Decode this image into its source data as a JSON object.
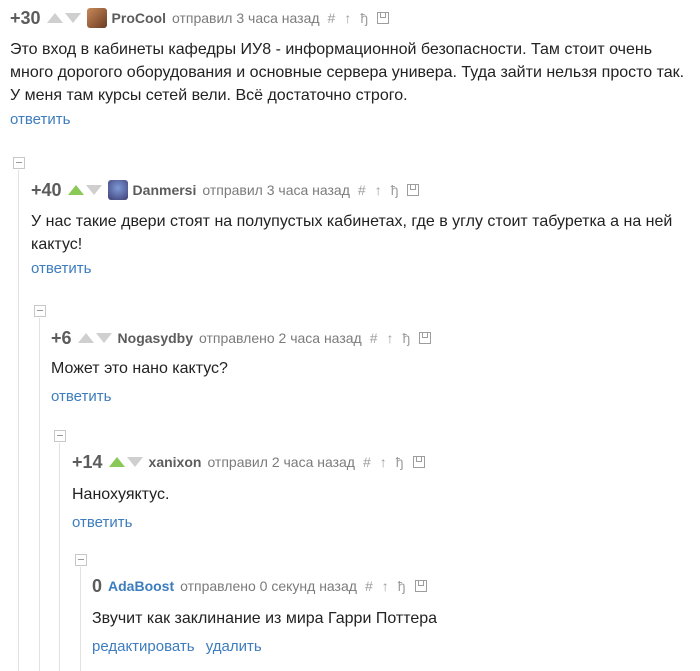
{
  "comments": [
    {
      "rating": "+30",
      "user": "ProCool",
      "action": "отправил 3 часа назад",
      "text": "Это вход в кабинеты кафедры ИУ8 - информационной безопасности. Там стоит очень много дорогого оборудования и основные сервера универа. Туда зайти нельзя просто так. У меня там курсы сетей вели. Всё достаточно строго.",
      "reply": "ответить"
    },
    {
      "rating": "+40",
      "user": "Danmersi",
      "action": "отправил 3 часа назад",
      "text": "У нас такие двери стоят на полупустых кабинетах, где в углу стоит табуретка а на ней кактус!",
      "reply": "ответить"
    },
    {
      "rating": "+6",
      "user": "Nogasydby",
      "action": "отправлено 2 часа назад",
      "text": "Может это нано кактус?",
      "reply": "ответить"
    },
    {
      "rating": "+14",
      "user": "xanixon",
      "action": "отправил 2 часа назад",
      "text": "Нанохуяктус.",
      "reply": "ответить"
    },
    {
      "rating": "0",
      "user": "AdaBoost",
      "action": "отправлено 0 секунд назад",
      "text": "Звучит как заклинание из мира Гарри Поттера",
      "edit": "редактировать",
      "delete": "удалить"
    }
  ],
  "icons": [
    "hash-icon",
    "up-to-parent-icon",
    "branch-icon",
    "save-icon"
  ]
}
